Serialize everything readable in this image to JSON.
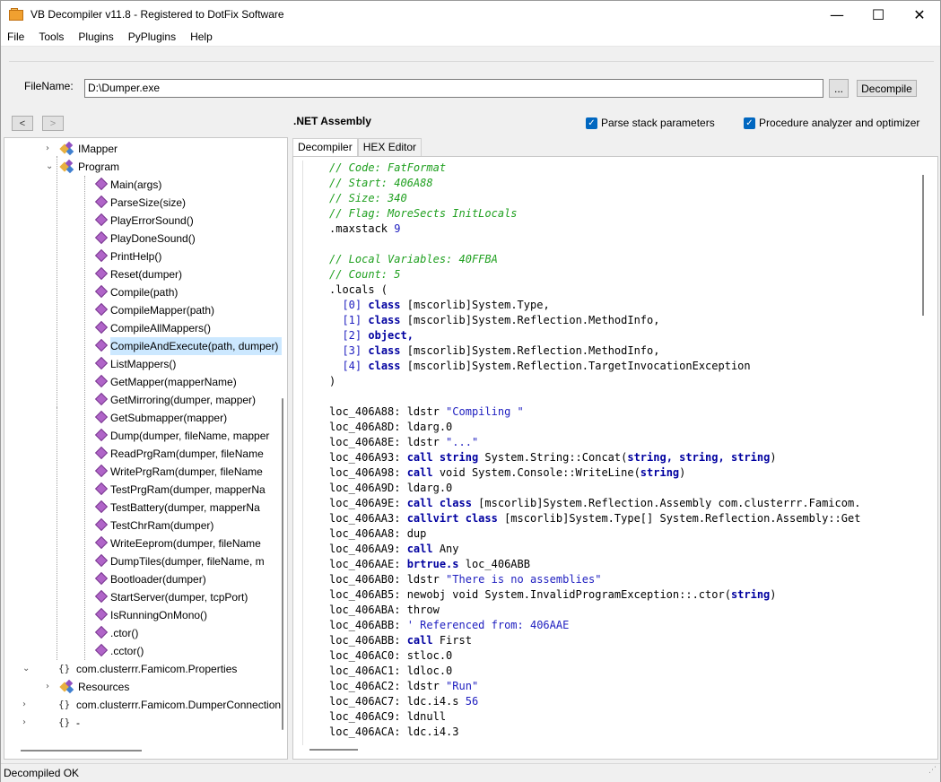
{
  "window": {
    "title": "VB Decompiler v11.8 - Registered to DotFix Software",
    "minimize": "—",
    "maximize": "☐",
    "close": "✕"
  },
  "menu": [
    "File",
    "Tools",
    "Plugins",
    "PyPlugins",
    "Help"
  ],
  "file": {
    "label": "FileName:",
    "value": "D:\\Dumper.exe",
    "browse_label": "...",
    "decompile_label": "Decompile"
  },
  "nav": {
    "back": "<",
    "forward": ">",
    "section_title": ".NET Assembly"
  },
  "options": {
    "parse_stack": "Parse stack parameters",
    "procedure_analyzer": "Procedure analyzer and optimizer"
  },
  "tree": {
    "items": [
      {
        "label": "IMapper",
        "type": "class",
        "expand": "›",
        "indent": 1
      },
      {
        "label": "Program",
        "type": "class",
        "expand": "⌄",
        "indent": 1
      },
      {
        "label": "Main(args)",
        "type": "method",
        "indent": 2
      },
      {
        "label": "ParseSize(size)",
        "type": "method",
        "indent": 2
      },
      {
        "label": "PlayErrorSound()",
        "type": "method",
        "indent": 2
      },
      {
        "label": "PlayDoneSound()",
        "type": "method",
        "indent": 2
      },
      {
        "label": "PrintHelp()",
        "type": "method",
        "indent": 2
      },
      {
        "label": "Reset(dumper)",
        "type": "method",
        "indent": 2
      },
      {
        "label": "Compile(path)",
        "type": "method",
        "indent": 2
      },
      {
        "label": "CompileMapper(path)",
        "type": "method",
        "indent": 2
      },
      {
        "label": "CompileAllMappers()",
        "type": "method",
        "indent": 2
      },
      {
        "label": "CompileAndExecute(path, dumper)",
        "type": "method",
        "indent": 2,
        "selected": true
      },
      {
        "label": "ListMappers()",
        "type": "method",
        "indent": 2
      },
      {
        "label": "GetMapper(mapperName)",
        "type": "method",
        "indent": 2
      },
      {
        "label": "GetMirroring(dumper, mapper)",
        "type": "method",
        "indent": 2
      },
      {
        "label": "GetSubmapper(mapper)",
        "type": "method",
        "indent": 2
      },
      {
        "label": "Dump(dumper, fileName, mapper",
        "type": "method",
        "indent": 2
      },
      {
        "label": "ReadPrgRam(dumper, fileName",
        "type": "method",
        "indent": 2
      },
      {
        "label": "WritePrgRam(dumper, fileName",
        "type": "method",
        "indent": 2
      },
      {
        "label": "TestPrgRam(dumper, mapperNa",
        "type": "method",
        "indent": 2
      },
      {
        "label": "TestBattery(dumper, mapperNa",
        "type": "method",
        "indent": 2
      },
      {
        "label": "TestChrRam(dumper)",
        "type": "method",
        "indent": 2
      },
      {
        "label": "WriteEeprom(dumper, fileName",
        "type": "method",
        "indent": 2
      },
      {
        "label": "DumpTiles(dumper, fileName, m",
        "type": "method",
        "indent": 2
      },
      {
        "label": "Bootloader(dumper)",
        "type": "method",
        "indent": 2
      },
      {
        "label": "StartServer(dumper, tcpPort)",
        "type": "method",
        "indent": 2
      },
      {
        "label": "IsRunningOnMono()",
        "type": "method",
        "indent": 2
      },
      {
        "label": ".ctor()",
        "type": "method",
        "indent": 2
      },
      {
        "label": ".cctor()",
        "type": "method",
        "indent": 2
      },
      {
        "label": "com.clusterrr.Famicom.Properties",
        "type": "namespace",
        "expand": "⌄",
        "indent": 0
      },
      {
        "label": "Resources",
        "type": "class",
        "expand": "›",
        "indent": 1
      },
      {
        "label": "com.clusterrr.Famicom.DumperConnection",
        "type": "namespace",
        "expand": "›",
        "indent": 0
      },
      {
        "label": "-",
        "type": "namespace",
        "expand": "›",
        "indent": 0
      }
    ]
  },
  "tabs": [
    "Decompiler",
    "HEX Editor"
  ],
  "code": [
    [
      {
        "c": "cm",
        "t": "// Code: FatFormat"
      }
    ],
    [
      {
        "c": "cm",
        "t": "// Start: 406A88"
      }
    ],
    [
      {
        "c": "cm",
        "t": "// Size: 340"
      }
    ],
    [
      {
        "c": "cm",
        "t": "// Flag: MoreSects InitLocals"
      }
    ],
    [
      {
        "c": "",
        "t": ".maxstack "
      },
      {
        "c": "nm",
        "t": "9"
      }
    ],
    [],
    [
      {
        "c": "cm",
        "t": "// Local Variables: 40FFBA"
      }
    ],
    [
      {
        "c": "cm",
        "t": "// Count: 5"
      }
    ],
    [
      {
        "c": "",
        "t": ".locals ("
      }
    ],
    [
      {
        "c": "",
        "t": "  "
      },
      {
        "c": "nm",
        "t": "[0]"
      },
      {
        "c": "",
        "t": " "
      },
      {
        "c": "kw",
        "t": "class"
      },
      {
        "c": "",
        "t": " [mscorlib]System.Type,"
      }
    ],
    [
      {
        "c": "",
        "t": "  "
      },
      {
        "c": "nm",
        "t": "[1]"
      },
      {
        "c": "",
        "t": " "
      },
      {
        "c": "kw",
        "t": "class"
      },
      {
        "c": "",
        "t": " [mscorlib]System.Reflection.MethodInfo,"
      }
    ],
    [
      {
        "c": "",
        "t": "  "
      },
      {
        "c": "nm",
        "t": "[2]"
      },
      {
        "c": "",
        "t": " "
      },
      {
        "c": "kw",
        "t": "object,"
      }
    ],
    [
      {
        "c": "",
        "t": "  "
      },
      {
        "c": "nm",
        "t": "[3]"
      },
      {
        "c": "",
        "t": " "
      },
      {
        "c": "kw",
        "t": "class"
      },
      {
        "c": "",
        "t": " [mscorlib]System.Reflection.MethodInfo,"
      }
    ],
    [
      {
        "c": "",
        "t": "  "
      },
      {
        "c": "nm",
        "t": "[4]"
      },
      {
        "c": "",
        "t": " "
      },
      {
        "c": "kw",
        "t": "class"
      },
      {
        "c": "",
        "t": " [mscorlib]System.Reflection.TargetInvocationException"
      }
    ],
    [
      {
        "c": "",
        "t": ")"
      }
    ],
    [],
    [
      {
        "c": "",
        "t": "loc_406A88: ldstr "
      },
      {
        "c": "st",
        "t": "\"Compiling \""
      }
    ],
    [
      {
        "c": "",
        "t": "loc_406A8D: ldarg.0"
      }
    ],
    [
      {
        "c": "",
        "t": "loc_406A8E: ldstr "
      },
      {
        "c": "st",
        "t": "\"...\""
      }
    ],
    [
      {
        "c": "",
        "t": "loc_406A93: "
      },
      {
        "c": "kw",
        "t": "call string"
      },
      {
        "c": "",
        "t": " System.String::Concat("
      },
      {
        "c": "kw",
        "t": "string, string, string"
      },
      {
        "c": "",
        "t": ")"
      }
    ],
    [
      {
        "c": "",
        "t": "loc_406A98: "
      },
      {
        "c": "kw",
        "t": "call"
      },
      {
        "c": "",
        "t": " void System.Console::WriteLine("
      },
      {
        "c": "kw",
        "t": "string"
      },
      {
        "c": "",
        "t": ")"
      }
    ],
    [
      {
        "c": "",
        "t": "loc_406A9D: ldarg.0"
      }
    ],
    [
      {
        "c": "",
        "t": "loc_406A9E: "
      },
      {
        "c": "kw",
        "t": "call class"
      },
      {
        "c": "",
        "t": " [mscorlib]System.Reflection.Assembly com.clusterrr.Famicom."
      }
    ],
    [
      {
        "c": "",
        "t": "loc_406AA3: "
      },
      {
        "c": "kw",
        "t": "callvirt class"
      },
      {
        "c": "",
        "t": " [mscorlib]System.Type[] System.Reflection.Assembly::Get"
      }
    ],
    [
      {
        "c": "",
        "t": "loc_406AA8: dup"
      }
    ],
    [
      {
        "c": "",
        "t": "loc_406AA9: "
      },
      {
        "c": "kw",
        "t": "call"
      },
      {
        "c": "",
        "t": " Any"
      }
    ],
    [
      {
        "c": "",
        "t": "loc_406AAE: "
      },
      {
        "c": "kw",
        "t": "brtrue.s"
      },
      {
        "c": "",
        "t": " loc_406ABB"
      }
    ],
    [
      {
        "c": "",
        "t": "loc_406AB0: ldstr "
      },
      {
        "c": "st",
        "t": "\"There is no assemblies\""
      }
    ],
    [
      {
        "c": "",
        "t": "loc_406AB5: newobj void System.InvalidProgramException::.ctor("
      },
      {
        "c": "kw",
        "t": "string"
      },
      {
        "c": "",
        "t": ")"
      }
    ],
    [
      {
        "c": "",
        "t": "loc_406ABA: throw"
      }
    ],
    [
      {
        "c": "",
        "t": "loc_406ABB: "
      },
      {
        "c": "st",
        "t": "' Referenced from: 406AAE"
      }
    ],
    [
      {
        "c": "",
        "t": "loc_406ABB: "
      },
      {
        "c": "kw",
        "t": "call"
      },
      {
        "c": "",
        "t": " First"
      }
    ],
    [
      {
        "c": "",
        "t": "loc_406AC0: stloc.0"
      }
    ],
    [
      {
        "c": "",
        "t": "loc_406AC1: ldloc.0"
      }
    ],
    [
      {
        "c": "",
        "t": "loc_406AC2: ldstr "
      },
      {
        "c": "st",
        "t": "\"Run\""
      }
    ],
    [
      {
        "c": "",
        "t": "loc_406AC7: ldc.i4.s "
      },
      {
        "c": "nm",
        "t": "56"
      }
    ],
    [
      {
        "c": "",
        "t": "loc_406AC9: ldnull"
      }
    ],
    [
      {
        "c": "",
        "t": "loc_406ACA: ldc.i4.3"
      }
    ]
  ],
  "status": "Decompiled OK"
}
